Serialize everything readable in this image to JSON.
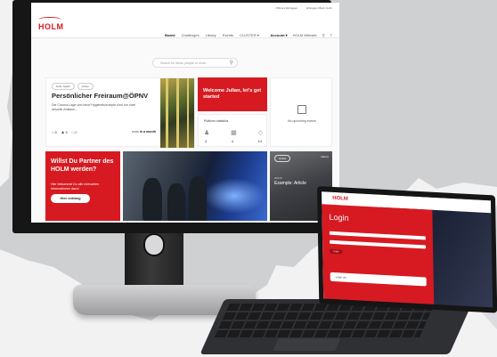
{
  "monitor": {
    "header": {
      "logo": "HOLM",
      "top_links": [
        "Offenes Einloggen",
        "Einloggen Beim Holm"
      ],
      "nav": [
        "Board",
        "Challenges",
        "Library",
        "Events",
        "CLUSTER ▾"
      ],
      "nav_right": [
        "Account ▾",
        "HOLM Website"
      ]
    },
    "search": {
      "placeholder": "Search for items, people or more..."
    },
    "feature_card": {
      "tags": [
        "Holm Spark",
        "Active"
      ],
      "title": "Persönlicher Freiraum@ÖPNV",
      "description": "Die Corona-Lage und neue Hygienekonzepte sind nur zwei aktuelle Anlässe...",
      "stats": [
        "5",
        "5",
        "2"
      ],
      "ends_prefix": "ends",
      "ends_value": "in a month"
    },
    "welcome_card": {
      "text": "Welcome Julian, let's get started"
    },
    "stats_card": {
      "label": "Platform statistics",
      "values": [
        "4",
        "4",
        "14"
      ]
    },
    "events_card": {
      "text": "No upcoming events"
    },
    "partner_card": {
      "title": "Willst Du Partner des HOLM werden?",
      "description": "Hier bekommst Du alle relevanten Informationen dazu!",
      "button": "Hier entlang"
    },
    "article_card": {
      "tag": "Article",
      "brand": "Allianz",
      "label": "HOLM",
      "title": "Example: Article"
    }
  },
  "laptop": {
    "logo": "HOLM",
    "heading": "Login",
    "button": "Login",
    "secondary_button": "Login via ..."
  },
  "colors": {
    "brand_red": "#d71a21",
    "monitor_bezel": "#161616"
  }
}
